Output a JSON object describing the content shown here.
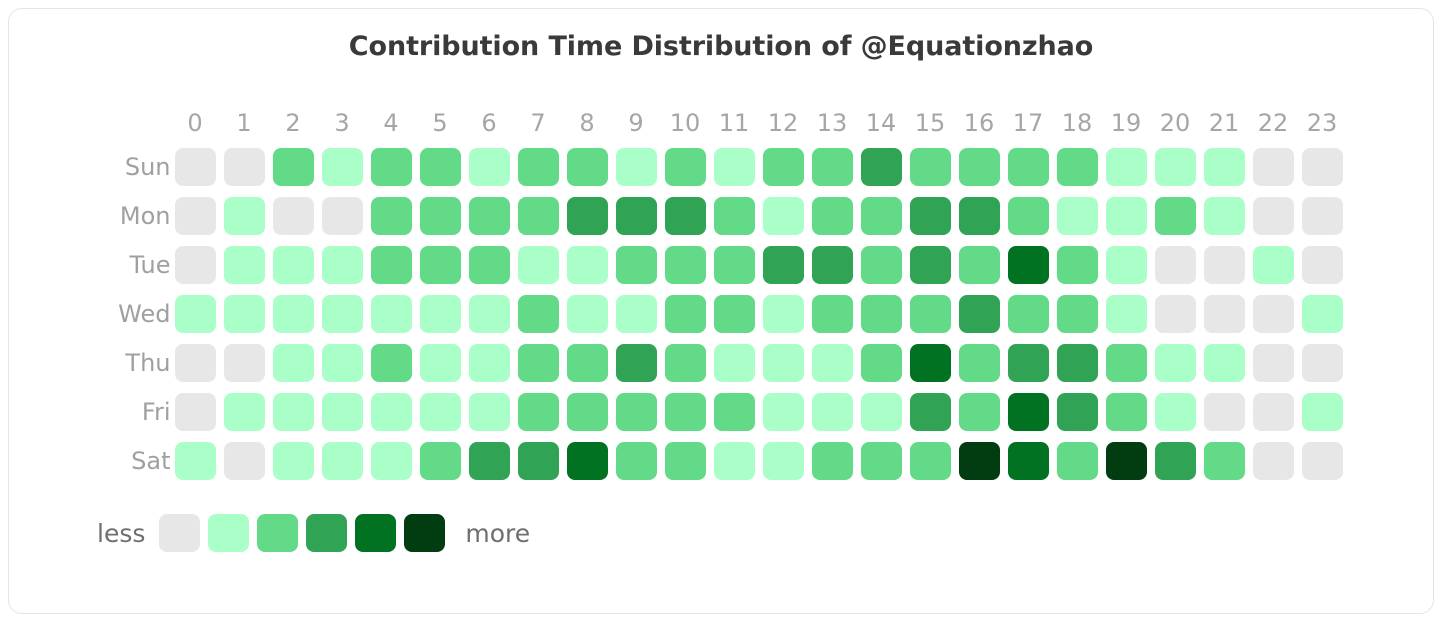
{
  "title": "Contribution Time Distribution of @Equationzhao",
  "legend": {
    "less_label": "less",
    "more_label": "more",
    "levels": [
      0,
      1,
      2,
      3,
      4,
      5
    ]
  },
  "palette": {
    "level0": "#e7e7e7",
    "level1": "#aaffc8",
    "level2": "#62da88",
    "level3": "#31a354",
    "level4": "#007222",
    "level5": "#023d11"
  },
  "chart_data": {
    "type": "heatmap",
    "title": "Contribution Time Distribution of @Equationzhao",
    "xlabel": "",
    "ylabel": "",
    "x_tick_labels": [
      "0",
      "1",
      "2",
      "3",
      "4",
      "5",
      "6",
      "7",
      "8",
      "9",
      "10",
      "11",
      "12",
      "13",
      "14",
      "15",
      "16",
      "17",
      "18",
      "19",
      "20",
      "21",
      "22",
      "23"
    ],
    "y_tick_labels": [
      "Sun",
      "Mon",
      "Tue",
      "Wed",
      "Thu",
      "Fri",
      "Sat"
    ],
    "colorbar": {
      "min_label": "less",
      "max_label": "more",
      "levels": [
        0,
        1,
        2,
        3,
        4,
        5
      ]
    },
    "rows": [
      {
        "day": "Sun",
        "values": [
          0,
          0,
          2,
          1,
          2,
          2,
          1,
          2,
          2,
          1,
          2,
          1,
          2,
          2,
          3,
          2,
          2,
          2,
          2,
          1,
          1,
          1,
          0,
          0
        ]
      },
      {
        "day": "Mon",
        "values": [
          0,
          1,
          0,
          0,
          2,
          2,
          2,
          2,
          3,
          3,
          3,
          2,
          1,
          2,
          2,
          3,
          3,
          2,
          1,
          1,
          2,
          1,
          0,
          0
        ]
      },
      {
        "day": "Tue",
        "values": [
          0,
          1,
          1,
          1,
          2,
          2,
          2,
          1,
          1,
          2,
          2,
          2,
          3,
          3,
          2,
          3,
          2,
          4,
          2,
          1,
          0,
          0,
          1,
          0
        ]
      },
      {
        "day": "Wed",
        "values": [
          1,
          1,
          1,
          1,
          1,
          1,
          1,
          2,
          1,
          1,
          2,
          2,
          1,
          2,
          2,
          2,
          3,
          2,
          2,
          1,
          0,
          0,
          0,
          1
        ]
      },
      {
        "day": "Thu",
        "values": [
          0,
          0,
          1,
          1,
          2,
          1,
          1,
          2,
          2,
          3,
          2,
          1,
          1,
          1,
          2,
          4,
          2,
          3,
          3,
          2,
          1,
          1,
          0,
          0
        ]
      },
      {
        "day": "Fri",
        "values": [
          0,
          1,
          1,
          1,
          1,
          1,
          1,
          2,
          2,
          2,
          2,
          2,
          1,
          1,
          1,
          3,
          2,
          4,
          3,
          2,
          1,
          0,
          0,
          1
        ]
      },
      {
        "day": "Sat",
        "values": [
          1,
          0,
          1,
          1,
          1,
          2,
          3,
          3,
          4,
          2,
          2,
          1,
          1,
          2,
          2,
          2,
          5,
          4,
          2,
          5,
          3,
          2,
          0,
          0
        ]
      }
    ]
  }
}
